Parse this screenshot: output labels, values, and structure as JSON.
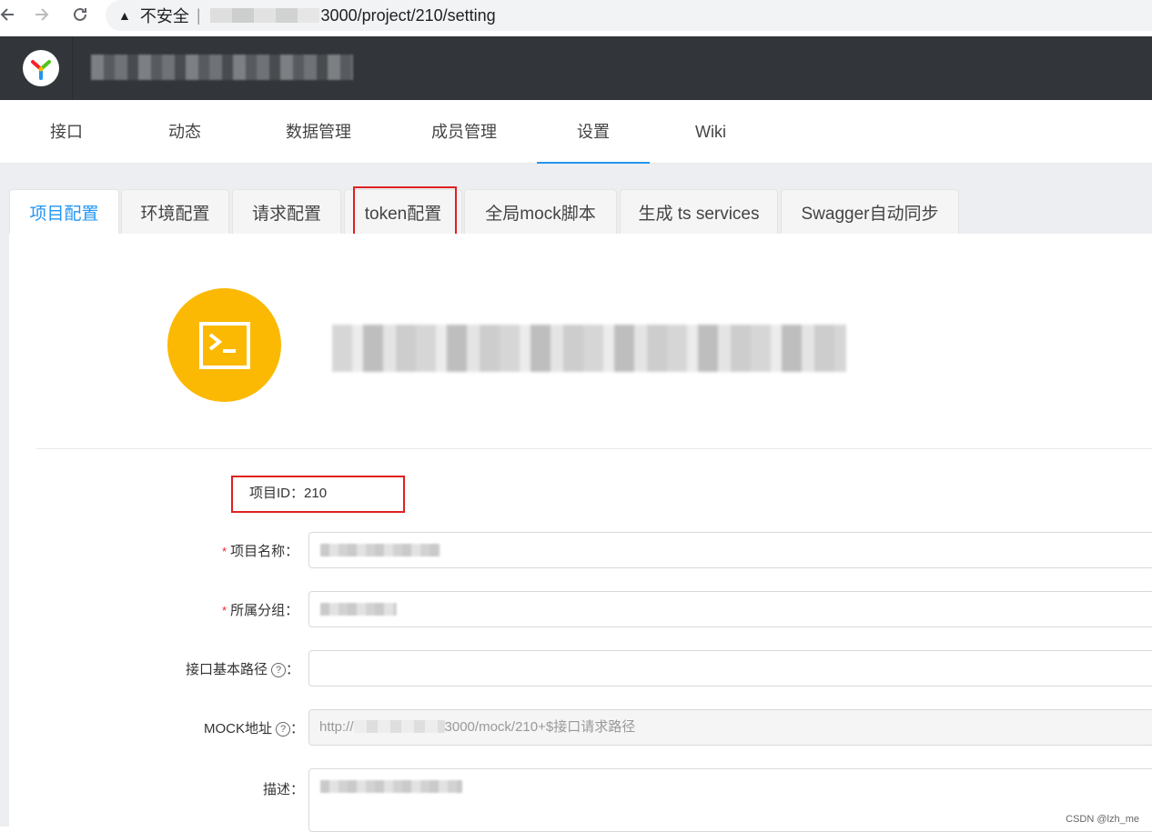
{
  "browser": {
    "back_icon": "arrow-left-icon",
    "forward_icon": "arrow-right-icon",
    "reload_icon": "reload-icon",
    "insecure_label": "不安全",
    "url_suffix": "3000/project/210/setting"
  },
  "top_nav": {
    "items": [
      "接口",
      "动态",
      "数据管理",
      "成员管理",
      "设置",
      "Wiki"
    ],
    "active": "设置"
  },
  "tabs": [
    "项目配置",
    "环境配置",
    "请求配置",
    "token配置",
    "全局mock脚本",
    "生成 ts services",
    "Swagger自动同步"
  ],
  "active_tab": "项目配置",
  "project": {
    "id_label": "项目ID：",
    "id_value": "210"
  },
  "form": {
    "name_label": "项目名称：",
    "group_label": "所属分组：",
    "basepath_label": "接口基本路径",
    "mock_label": "MOCK地址",
    "mock_prefix": "http://",
    "mock_suffix": "3000/mock/210+$接口请求路径",
    "desc_label": "描述：",
    "colon": "：",
    "help_glyph": "?"
  },
  "watermark": "CSDN @lzh_me",
  "colors": {
    "accent": "#2395f1",
    "header": "#32363a",
    "avatar": "#fbb903",
    "highlight_box": "#e02020"
  }
}
